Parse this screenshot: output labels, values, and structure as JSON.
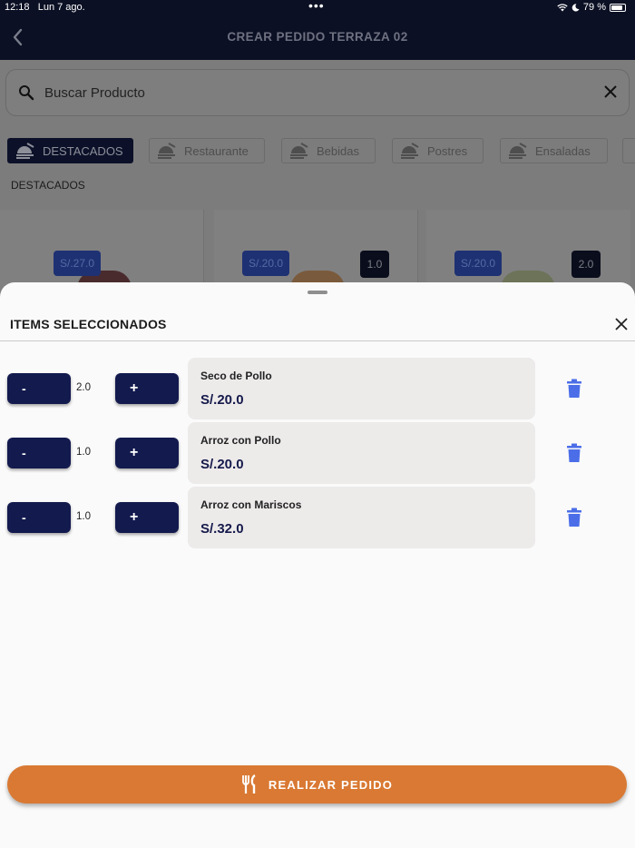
{
  "status_bar": {
    "time": "12:18",
    "date": "Lun 7 ago.",
    "battery": "79 %"
  },
  "header": {
    "title": "CREAR PEDIDO TERRAZA 02"
  },
  "search": {
    "placeholder": "Buscar Producto"
  },
  "categories": [
    {
      "label": "DESTACADOS",
      "active": true
    },
    {
      "label": "Restaurante",
      "active": false
    },
    {
      "label": "Bebidas",
      "active": false
    },
    {
      "label": "Postres",
      "active": false
    },
    {
      "label": "Ensaladas",
      "active": false
    }
  ],
  "section_label": "DESTACADOS",
  "products": [
    {
      "price": "S/.27.0",
      "qty": ""
    },
    {
      "price": "S/.20.0",
      "qty": "1.0"
    },
    {
      "price": "S/.20.0",
      "qty": "2.0"
    }
  ],
  "sheet": {
    "title": "ITEMS SELECCIONADOS",
    "minus_label": "-",
    "plus_label": "+",
    "items": [
      {
        "qty": "2.0",
        "name": "Seco de Pollo",
        "price": "S/.20.0"
      },
      {
        "qty": "1.0",
        "name": "Arroz con Pollo",
        "price": "S/.20.0"
      },
      {
        "qty": "1.0",
        "name": "Arroz con Mariscos",
        "price": "S/.32.0"
      }
    ],
    "order_button": "REALIZAR PEDIDO"
  },
  "colors": {
    "navy": "#131a4e",
    "orange": "#d97933",
    "trash_blue": "#4b6ee8"
  }
}
